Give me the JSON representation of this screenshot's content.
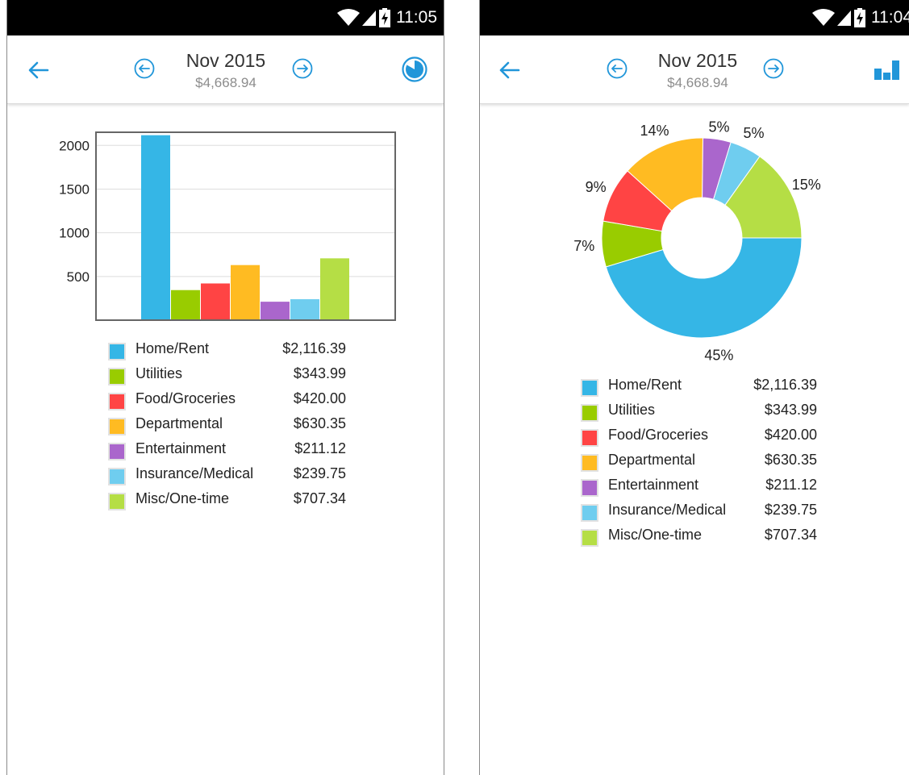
{
  "status_bar": {
    "left_time": "11:05",
    "right_time": "11:04"
  },
  "header": {
    "month": "Nov 2015",
    "total": "$4,668.94"
  },
  "icons": {
    "back": "arrow-left-icon",
    "prev": "circle-arrow-left-icon",
    "next": "circle-arrow-right-icon",
    "pie_toggle": "pie-chart-icon",
    "bar_toggle": "bar-chart-icon",
    "wifi": "wifi-icon",
    "signal": "signal-icon",
    "battery": "battery-charging-icon"
  },
  "colors": {
    "accent": "#2196d9"
  },
  "categories": [
    {
      "name": "Home/Rent",
      "amount": "$2,116.39",
      "color": "#35b6e6"
    },
    {
      "name": "Utilities",
      "amount": "$343.99",
      "color": "#99cc00"
    },
    {
      "name": "Food/Groceries",
      "amount": "$420.00",
      "color": "#ff4444"
    },
    {
      "name": "Departmental",
      "amount": "$630.35",
      "color": "#ffbb22"
    },
    {
      "name": "Entertainment",
      "amount": "$211.12",
      "color": "#aa66cc"
    },
    {
      "name": "Insurance/Medical",
      "amount": "$239.75",
      "color": "#6fcdef"
    },
    {
      "name": "Misc/One-time",
      "amount": "$707.34",
      "color": "#b5de45"
    }
  ],
  "chart_data": [
    {
      "type": "bar",
      "categories": [
        "Home/Rent",
        "Utilities",
        "Food/Groceries",
        "Departmental",
        "Entertainment",
        "Insurance/Medical",
        "Misc/One-time"
      ],
      "values": [
        2116.39,
        343.99,
        420.0,
        630.35,
        211.12,
        239.75,
        707.34
      ],
      "yticks": [
        "500",
        "1000",
        "1500",
        "2000"
      ],
      "ylim": [
        0,
        2150
      ],
      "grid": true,
      "legend": "below"
    },
    {
      "type": "pie",
      "style": "donut",
      "labels": [
        "Home/Rent",
        "Utilities",
        "Food/Groceries",
        "Departmental",
        "Entertainment",
        "Insurance/Medical",
        "Misc/One-time"
      ],
      "values": [
        2116.39,
        343.99,
        420.0,
        630.35,
        211.12,
        239.75,
        707.34
      ],
      "percent_labels": [
        "45%",
        "7%",
        "9%",
        "14%",
        "5%",
        "5%",
        "15%"
      ],
      "legend": "below"
    }
  ]
}
